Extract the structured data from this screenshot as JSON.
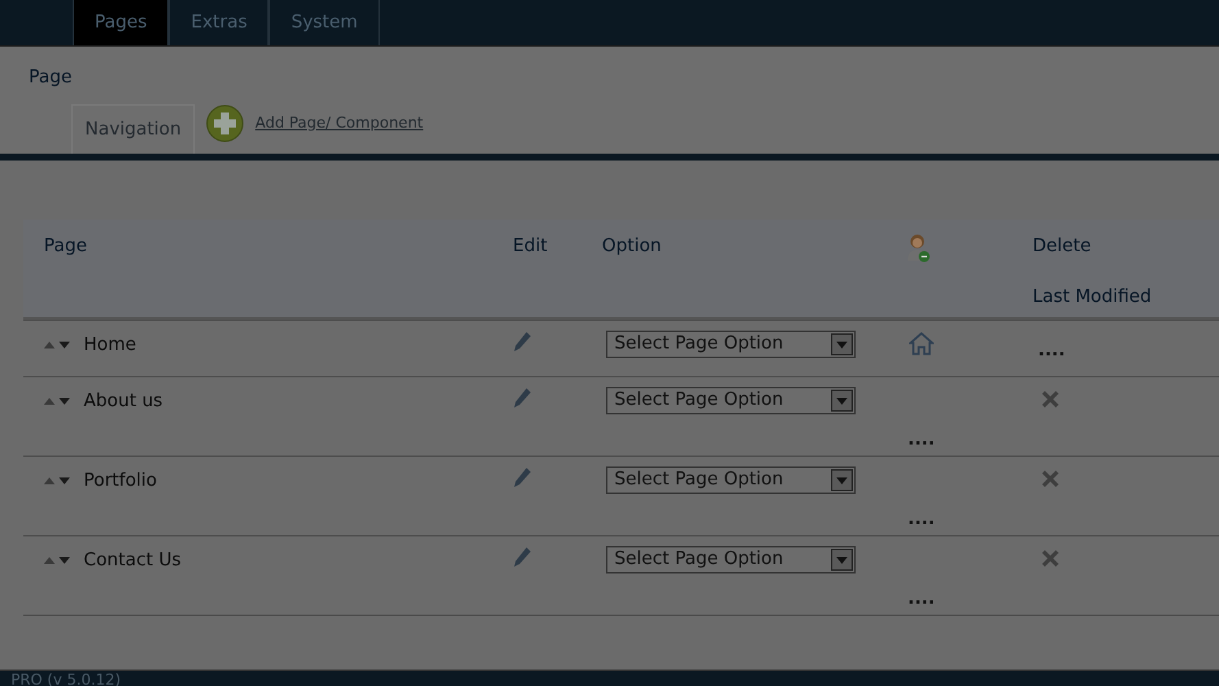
{
  "top_nav": {
    "tabs": [
      {
        "label": "Pages",
        "selected": true
      },
      {
        "label": "Extras",
        "selected": false
      },
      {
        "label": "System",
        "selected": false
      }
    ]
  },
  "page_title": "Page",
  "sub_tabs": [
    {
      "label": "Navigation",
      "selected": true
    }
  ],
  "add_link": "Add Page/ Component",
  "table": {
    "columns": {
      "page": "Page",
      "edit": "Edit",
      "option": "Option",
      "delete": "Delete",
      "last_modified": "Last Modified"
    },
    "rows": [
      {
        "kind": "home",
        "name": "Home",
        "option": "Select Page Option",
        "modified": "...."
      },
      {
        "kind": "page",
        "name": "About us",
        "option": "Select Page Option",
        "modified": "...."
      },
      {
        "kind": "page",
        "name": "Portfolio",
        "option": "Select Page Option",
        "modified": "...."
      },
      {
        "kind": "page",
        "name": "Contact Us",
        "option": "Select Page Option",
        "modified": "...."
      }
    ]
  },
  "status_bar": "PRO (v 5.0.12)"
}
